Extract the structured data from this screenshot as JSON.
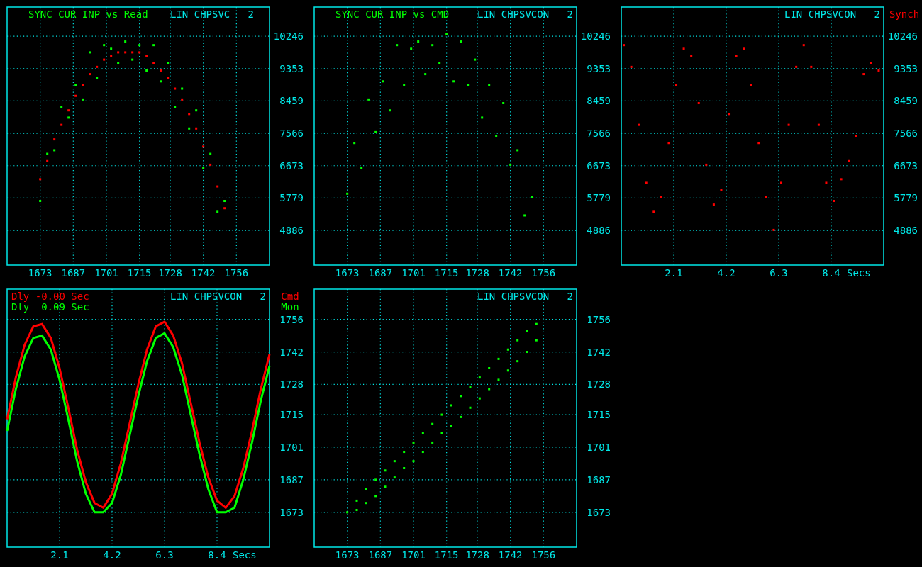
{
  "panels": [
    {
      "heading": "SYNC CUR INP vs Read",
      "mode": "LIN CHPSVC",
      "channel": "2",
      "chart_data": {
        "type": "scatter",
        "grid": true,
        "xlim": [
          1659,
          1770
        ],
        "ylim": [
          3930,
          11050
        ],
        "xticks": [
          1673,
          1687,
          1701,
          1715,
          1728,
          1742,
          1756
        ],
        "yticks": [
          10246,
          9353,
          8459,
          7566,
          6673,
          5779,
          4886
        ],
        "x": [
          1673,
          1676,
          1679,
          1682,
          1685,
          1688,
          1691,
          1694,
          1697,
          1700,
          1703,
          1706,
          1709,
          1712,
          1715,
          1718,
          1721,
          1724,
          1727,
          1730,
          1733,
          1736,
          1739,
          1742,
          1745,
          1748,
          1751
        ],
        "series": [
          {
            "color": "#00ff00",
            "values": [
              5700,
              7000,
              7100,
              8300,
              8000,
              8900,
              8500,
              9800,
              9100,
              10000,
              9900,
              9500,
              10100,
              9600,
              10000,
              9300,
              10000,
              9000,
              9500,
              8300,
              8800,
              7700,
              8200,
              6600,
              7000,
              5400,
              5700
            ]
          },
          {
            "color": "#ff0000",
            "values": [
              6300,
              6800,
              7400,
              7800,
              8200,
              8600,
              8900,
              9200,
              9400,
              9600,
              9700,
              9800,
              9800,
              9800,
              9800,
              9700,
              9500,
              9300,
              9100,
              8800,
              8500,
              8100,
              7700,
              7200,
              6700,
              6100,
              5500
            ]
          }
        ]
      }
    },
    {
      "heading": "SYNC CUR INP vs CMD",
      "mode": "LIN CHPSVCON",
      "channel": "2",
      "chart_data": {
        "type": "scatter",
        "grid": true,
        "xlim": [
          1659,
          1770
        ],
        "ylim": [
          3930,
          11050
        ],
        "xticks": [
          1673,
          1687,
          1701,
          1715,
          1728,
          1742,
          1756
        ],
        "yticks": [
          10246,
          9353,
          8459,
          7566,
          6673,
          5779,
          4886
        ],
        "x": [
          1673,
          1676,
          1679,
          1682,
          1685,
          1688,
          1691,
          1694,
          1697,
          1700,
          1703,
          1706,
          1709,
          1712,
          1715,
          1718,
          1721,
          1724,
          1727,
          1730,
          1733,
          1736,
          1739,
          1742,
          1745,
          1748,
          1751
        ],
        "series": [
          {
            "color": "#00ff00",
            "values": [
              5900,
              7300,
              6600,
              8500,
              7600,
              9000,
              8200,
              10000,
              8900,
              9900,
              10100,
              9200,
              10000,
              9500,
              10300,
              9000,
              10100,
              8900,
              9600,
              8000,
              8900,
              7500,
              8400,
              6700,
              7100,
              5300,
              5800
            ]
          }
        ]
      }
    },
    {
      "mode": "LIN CHPSVCON",
      "channel": "2",
      "chart_data": {
        "type": "scatter",
        "grid": true,
        "xlim": [
          0,
          10.5
        ],
        "ylim": [
          3930,
          11050
        ],
        "xticks": [
          2.1,
          4.2,
          6.3,
          8.4
        ],
        "xlabel": "Secs",
        "yticks": [
          10246,
          9353,
          8459,
          7566,
          6673,
          5779,
          4886
        ],
        "x": [
          0.1,
          0.4,
          0.7,
          1.0,
          1.3,
          1.6,
          1.9,
          2.2,
          2.5,
          2.8,
          3.1,
          3.4,
          3.7,
          4.0,
          4.3,
          4.6,
          4.9,
          5.2,
          5.5,
          5.8,
          6.1,
          6.4,
          6.7,
          7.0,
          7.3,
          7.6,
          7.9,
          8.2,
          8.5,
          8.8,
          9.1,
          9.4,
          9.7,
          10.0,
          10.3
        ],
        "series": [
          {
            "name": "Synch",
            "color": "#ff0000",
            "values": [
              10000,
              9400,
              7800,
              6200,
              5400,
              5800,
              7300,
              8900,
              9900,
              9700,
              8400,
              6700,
              5600,
              6000,
              8100,
              9700,
              9900,
              8900,
              7300,
              5800,
              4900,
              6200,
              7800,
              9400,
              10000,
              9400,
              7800,
              6200,
              5700,
              6300,
              6800,
              7500,
              9200,
              9500,
              9300
            ]
          }
        ]
      }
    },
    {
      "mode": "LIN CHPSVCON",
      "channel": "2",
      "legend": [
        {
          "text": "Dly -0.00 Sec",
          "color": "#ff0000"
        },
        {
          "text": "Dly  0.09 Sec",
          "color": "#00ff00"
        }
      ],
      "chart_data": {
        "type": "line",
        "grid": true,
        "xlim": [
          0,
          10.5
        ],
        "ylim": [
          1658,
          1769
        ],
        "xticks": [
          2.1,
          4.2,
          6.3,
          8.4
        ],
        "xlabel": "Secs",
        "yticks": [
          1756,
          1742,
          1728,
          1715,
          1701,
          1687,
          1673
        ],
        "x": [
          0,
          0.35,
          0.7,
          1.05,
          1.4,
          1.75,
          2.1,
          2.45,
          2.8,
          3.15,
          3.5,
          3.85,
          4.2,
          4.55,
          4.9,
          5.25,
          5.6,
          5.95,
          6.3,
          6.65,
          7.0,
          7.35,
          7.7,
          8.05,
          8.4,
          8.75,
          9.1,
          9.45,
          9.8,
          10.15,
          10.5
        ],
        "series": [
          {
            "name": "Cmd",
            "color": "#ff0000",
            "values": [
              1713,
              1731,
              1745,
              1753,
              1754,
              1748,
              1735,
              1718,
              1700,
              1686,
              1677,
              1675,
              1681,
              1694,
              1711,
              1728,
              1743,
              1753,
              1755,
              1749,
              1737,
              1720,
              1703,
              1688,
              1678,
              1675,
              1680,
              1692,
              1708,
              1726,
              1741
            ]
          },
          {
            "name": "Mon",
            "color": "#00ff00",
            "values": [
              1708,
              1726,
              1740,
              1748,
              1749,
              1743,
              1730,
              1713,
              1695,
              1681,
              1673,
              1673,
              1677,
              1689,
              1706,
              1723,
              1738,
              1748,
              1750,
              1744,
              1732,
              1715,
              1698,
              1683,
              1673,
              1673,
              1675,
              1687,
              1703,
              1721,
              1736
            ]
          }
        ]
      }
    },
    {
      "mode": "LIN CHPSVCON",
      "channel": "2",
      "chart_data": {
        "type": "scatter",
        "grid": true,
        "xlim": [
          1659,
          1770
        ],
        "ylim": [
          1658,
          1769
        ],
        "xticks": [
          1673,
          1687,
          1701,
          1715,
          1728,
          1742,
          1756
        ],
        "yticks": [
          1756,
          1742,
          1728,
          1715,
          1701,
          1687,
          1673
        ],
        "x": [
          1673,
          1677,
          1681,
          1685,
          1689,
          1693,
          1697,
          1701,
          1705,
          1709,
          1713,
          1717,
          1721,
          1725,
          1729,
          1733,
          1737,
          1741,
          1745,
          1749,
          1753
        ],
        "series": [
          {
            "color": "#00ff00",
            "values": [
              1673,
              1678,
              1683,
              1687,
              1691,
              1695,
              1699,
              1703,
              1707,
              1711,
              1715,
              1719,
              1723,
              1727,
              1731,
              1735,
              1739,
              1743,
              1747,
              1751,
              1754
            ]
          },
          {
            "color": "#00ff00",
            "values": [
              null,
              1674,
              1677,
              1680,
              1684,
              1688,
              1692,
              1695,
              1699,
              1703,
              1707,
              1710,
              1714,
              1718,
              1722,
              1726,
              1730,
              1734,
              1738,
              1742,
              1747
            ]
          }
        ]
      }
    }
  ]
}
